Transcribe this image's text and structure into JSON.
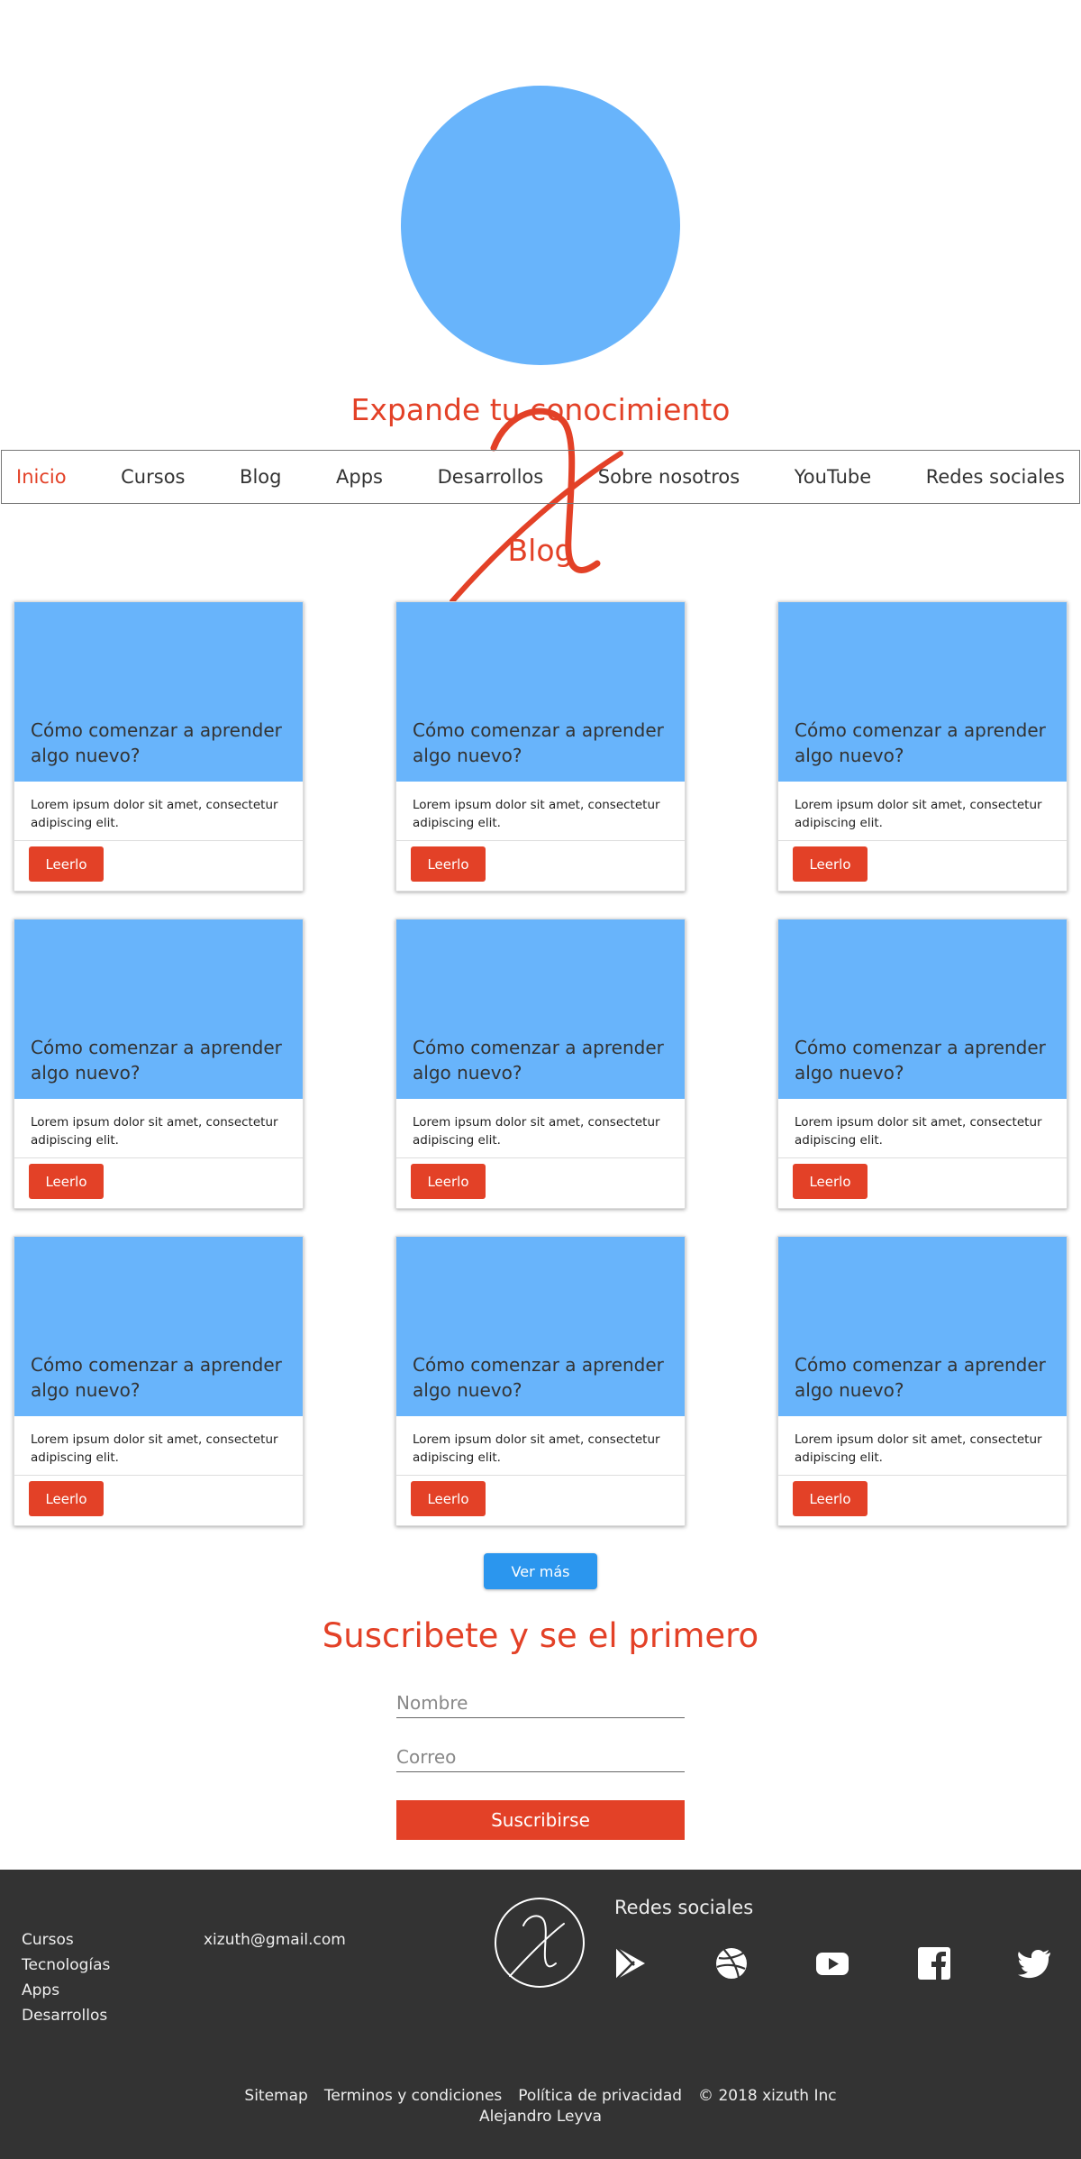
{
  "brand": {
    "tagline": "Expande tu conocimiento",
    "accent_color": "#e34127",
    "logo_color": "#68b4fb",
    "footer_bg": "#333333"
  },
  "nav": {
    "items": [
      {
        "label": "Inicio",
        "active": true
      },
      {
        "label": "Cursos"
      },
      {
        "label": "Blog"
      },
      {
        "label": "Apps"
      },
      {
        "label": "Desarrollos"
      },
      {
        "label": "Sobre nosotros"
      },
      {
        "label": "YouTube"
      },
      {
        "label": "Redes sociales"
      }
    ]
  },
  "blog": {
    "title": "Blog",
    "cards": [
      {
        "title": "Cómo comenzar a aprender algo nuevo?",
        "text": "Lorem ipsum dolor sit amet, consectetur adipiscing elit.",
        "button": "Leerlo"
      },
      {
        "title": "Cómo comenzar a aprender algo nuevo?",
        "text": "Lorem ipsum dolor sit amet, consectetur adipiscing elit.",
        "button": "Leerlo"
      },
      {
        "title": "Cómo comenzar a aprender algo nuevo?",
        "text": "Lorem ipsum dolor sit amet, consectetur adipiscing elit.",
        "button": "Leerlo"
      },
      {
        "title": "Cómo comenzar a aprender algo nuevo?",
        "text": "Lorem ipsum dolor sit amet, consectetur adipiscing elit.",
        "button": "Leerlo"
      },
      {
        "title": "Cómo comenzar a aprender algo nuevo?",
        "text": "Lorem ipsum dolor sit amet, consectetur adipiscing elit.",
        "button": "Leerlo"
      },
      {
        "title": "Cómo comenzar a aprender algo nuevo?",
        "text": "Lorem ipsum dolor sit amet, consectetur adipiscing elit.",
        "button": "Leerlo"
      },
      {
        "title": "Cómo comenzar a aprender algo nuevo?",
        "text": "Lorem ipsum dolor sit amet, consectetur adipiscing elit.",
        "button": "Leerlo"
      },
      {
        "title": "Cómo comenzar a aprender algo nuevo?",
        "text": "Lorem ipsum dolor sit amet, consectetur adipiscing elit.",
        "button": "Leerlo"
      },
      {
        "title": "Cómo comenzar a aprender algo nuevo?",
        "text": "Lorem ipsum dolor sit amet, consectetur adipiscing elit.",
        "button": "Leerlo"
      }
    ],
    "more_button": "Ver más"
  },
  "subscribe": {
    "title": "Suscribete y se el primero",
    "name_placeholder": "Nombre",
    "email_placeholder": "Correo",
    "button": "Suscribirse"
  },
  "footer": {
    "links": [
      "Cursos",
      "Tecnologías",
      "Apps",
      "Desarrollos"
    ],
    "email": "xizuth@gmail.com",
    "social_title": "Redes sociales",
    "social_icons": [
      "google-play-icon",
      "dribbble-icon",
      "youtube-icon",
      "facebook-icon",
      "twitter-icon"
    ],
    "bottom_links": [
      "Sitemap",
      "Terminos y condiciones",
      "Política de privacidad"
    ],
    "copyright": "© 2018 xizuth Inc",
    "author": "Alejandro Leyva"
  }
}
